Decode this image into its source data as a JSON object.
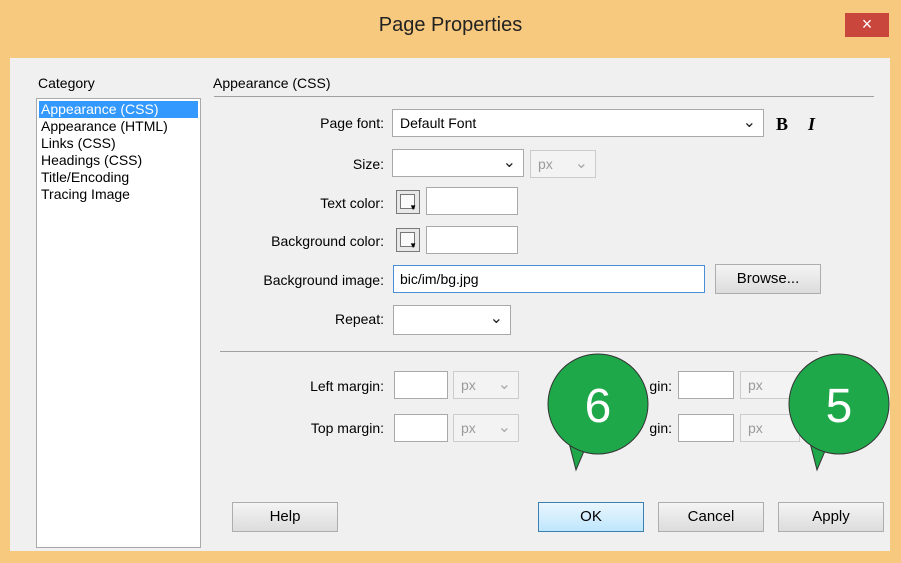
{
  "window": {
    "title": "Page Properties",
    "close": "×"
  },
  "category": {
    "title": "Category",
    "items": [
      "Appearance (CSS)",
      "Appearance (HTML)",
      "Links (CSS)",
      "Headings (CSS)",
      "Title/Encoding",
      "Tracing Image"
    ],
    "selected": "Appearance (CSS)"
  },
  "section": {
    "title": "Appearance (CSS)"
  },
  "fields": {
    "page_font": {
      "label": "Page font:",
      "value": "Default Font"
    },
    "bold": "B",
    "italic": "I",
    "size": {
      "label": "Size:",
      "value": "",
      "unit": "px"
    },
    "text_color": {
      "label": "Text color:",
      "value": ""
    },
    "background_color": {
      "label": "Background color:",
      "value": ""
    },
    "background_image": {
      "label": "Background image:",
      "value": "bic/im/bg.jpg",
      "browse": "Browse..."
    },
    "repeat": {
      "label": "Repeat:",
      "value": ""
    },
    "left_margin": {
      "label": "Left margin:",
      "unit": "px"
    },
    "right_margin": {
      "label_partial": "gin:",
      "unit": "px"
    },
    "top_margin": {
      "label": "Top margin:",
      "unit": "px"
    },
    "bottom_margin": {
      "label_partial": "gin:",
      "unit": "px"
    }
  },
  "buttons": {
    "help": "Help",
    "ok": "OK",
    "cancel": "Cancel",
    "apply": "Apply"
  },
  "annotations": {
    "badge_ok": "6",
    "badge_apply": "5",
    "color": "#1fa84a"
  }
}
